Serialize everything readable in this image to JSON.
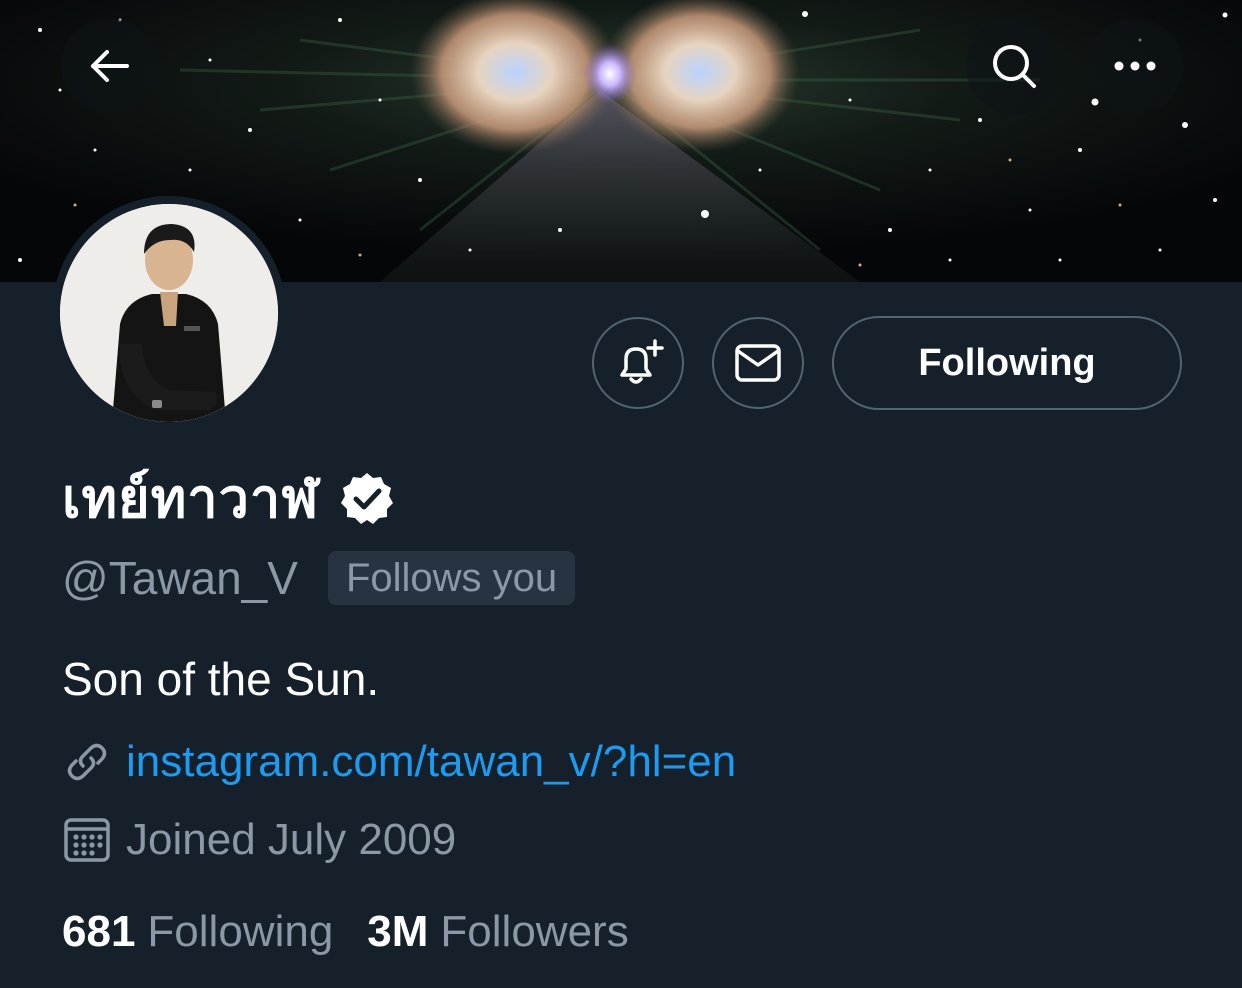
{
  "header": {
    "back_icon": "arrow-left-icon",
    "search_icon": "search-icon",
    "more_icon": "more-horizontal-icon"
  },
  "actions": {
    "notify_icon": "bell-plus-icon",
    "message_icon": "envelope-icon",
    "following_label": "Following"
  },
  "profile": {
    "display_name": "เทย์ทาวาฬ",
    "verified_icon": "verified-badge-icon",
    "handle": "@Tawan_V",
    "follows_you_label": "Follows you",
    "bio": "Son of the Sun.",
    "link_icon": "link-icon",
    "link_text": "instagram.com/tawan_v/?hl=en",
    "calendar_icon": "calendar-icon",
    "joined_text": "Joined July 2009"
  },
  "stats": {
    "following_count": "681",
    "following_label": "Following",
    "followers_count": "3M",
    "followers_label": "Followers"
  },
  "colors": {
    "background": "#15202b",
    "secondary_text": "#8b98a5",
    "link": "#1d9bf0",
    "button_border": "#536471",
    "badge_background": "#273340"
  }
}
